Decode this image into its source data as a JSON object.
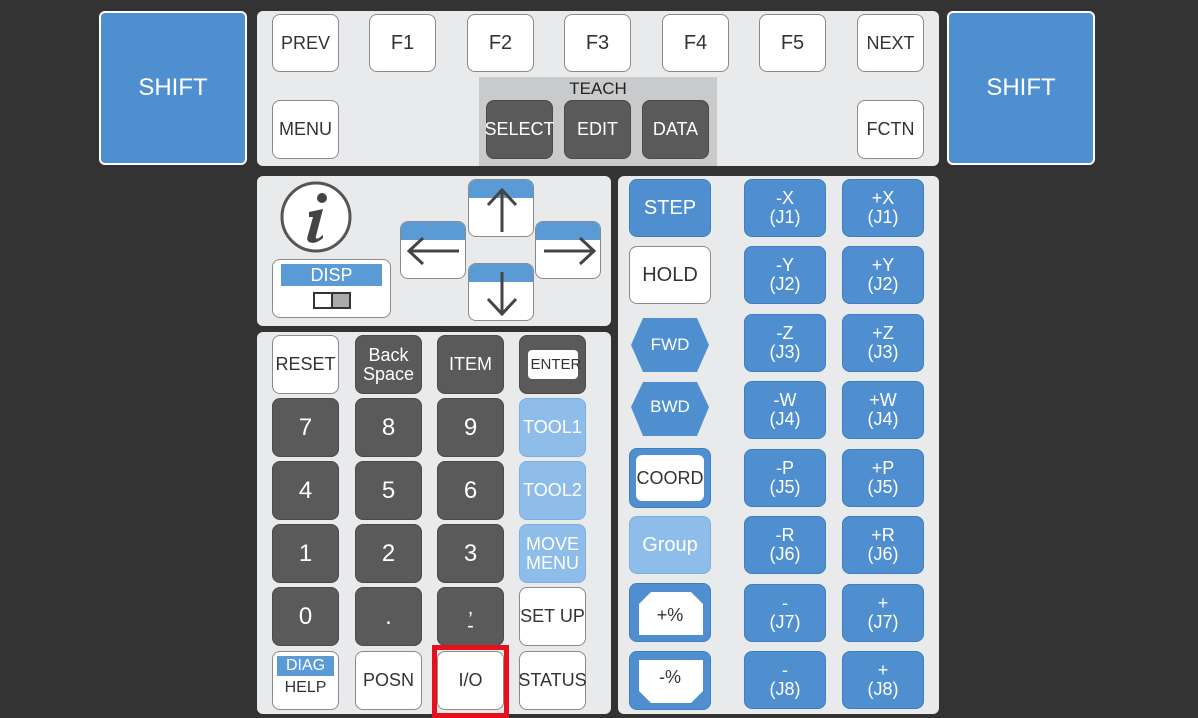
{
  "shift": {
    "left": "SHIFT",
    "right": "SHIFT"
  },
  "top": {
    "prev": "PREV",
    "f1": "F1",
    "f2": "F2",
    "f3": "F3",
    "f4": "F4",
    "f5": "F5",
    "next": "NEXT",
    "menu": "MENU",
    "fctn": "FCTN",
    "teach_label": "TEACH",
    "select": "SELECT",
    "edit": "EDIT",
    "data": "DATA"
  },
  "nav": {
    "disp": "DISP"
  },
  "keypad": {
    "reset": "RESET",
    "backspace_1": "Back",
    "backspace_2": "Space",
    "item": "ITEM",
    "enter": "ENTER",
    "k7": "7",
    "k8": "8",
    "k9": "9",
    "tool1": "TOOL1",
    "k4": "4",
    "k5": "5",
    "k6": "6",
    "tool2": "TOOL2",
    "k1": "1",
    "k2": "2",
    "k3": "3",
    "move_1": "MOVE",
    "move_2": "MENU",
    "k0": "0",
    "dot": ".",
    "comma_1": ",",
    "comma_2": "-",
    "setup": "SET UP",
    "diag": "DIAG",
    "help": "HELP",
    "posn": "POSN",
    "io": "I/O",
    "status": "STATUS"
  },
  "motion": {
    "step": "STEP",
    "hold": "HOLD",
    "fwd": "FWD",
    "bwd": "BWD",
    "coord": "COORD",
    "group": "Group",
    "plus_pct": "+%",
    "minus_pct": "-%"
  },
  "jog": {
    "minus": [
      {
        "axis": "-X",
        "joint": "(J1)"
      },
      {
        "axis": "-Y",
        "joint": "(J2)"
      },
      {
        "axis": "-Z",
        "joint": "(J3)"
      },
      {
        "axis": "-W",
        "joint": "(J4)"
      },
      {
        "axis": "-P",
        "joint": "(J5)"
      },
      {
        "axis": "-R",
        "joint": "(J6)"
      },
      {
        "axis": "-",
        "joint": "(J7)"
      },
      {
        "axis": "-",
        "joint": "(J8)"
      }
    ],
    "plus": [
      {
        "axis": "+X",
        "joint": "(J1)"
      },
      {
        "axis": "+Y",
        "joint": "(J2)"
      },
      {
        "axis": "+Z",
        "joint": "(J3)"
      },
      {
        "axis": "+W",
        "joint": "(J4)"
      },
      {
        "axis": "+P",
        "joint": "(J5)"
      },
      {
        "axis": "+R",
        "joint": "(J6)"
      },
      {
        "axis": "+",
        "joint": "(J7)"
      },
      {
        "axis": "+",
        "joint": "(J8)"
      }
    ]
  },
  "colors": {
    "background": "#333333",
    "panel": "#e9eaec",
    "blue": "#4f8fd0",
    "light_blue": "#8fbdea",
    "dark_key": "#5a5a5a",
    "highlight": "#e8101a"
  },
  "icons": [
    "info-icon",
    "arrow-left-icon",
    "arrow-up-icon",
    "arrow-right-icon",
    "arrow-down-icon",
    "disp-toggle-icon"
  ],
  "highlighted_key": "io"
}
